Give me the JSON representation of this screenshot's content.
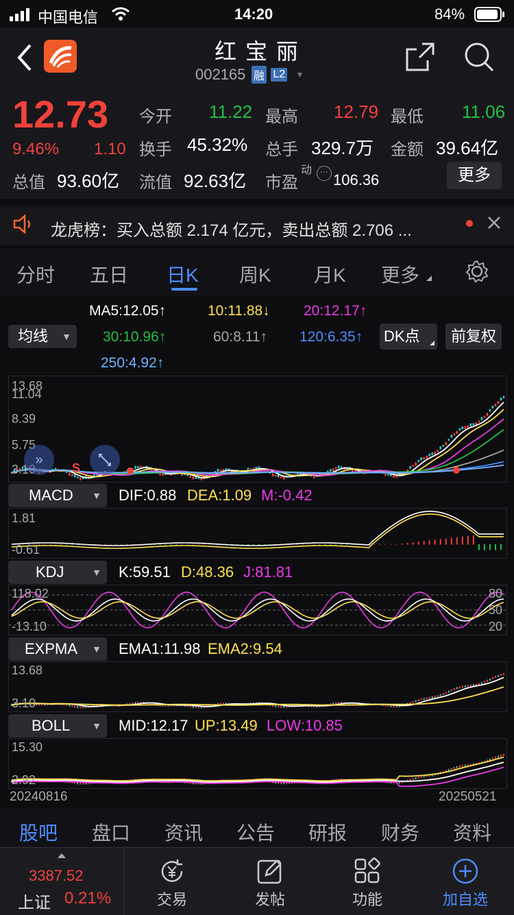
{
  "status": {
    "carrier": "中国电信",
    "time": "14:20",
    "battery": "84%"
  },
  "header": {
    "name": "红 宝 丽",
    "code": "002165",
    "badge_rong": "融",
    "badge_l2": "L2"
  },
  "quote": {
    "price": "12.73",
    "change_pct": "9.46%",
    "change": "1.10",
    "open_label": "今开",
    "open": "11.22",
    "high_label": "最高",
    "high": "12.79",
    "low_label": "最低",
    "low": "11.06",
    "turnover_label": "换手",
    "turnover": "45.32%",
    "volume_label": "总手",
    "volume": "329.7万",
    "amount_label": "金额",
    "amount": "39.64亿",
    "mktcap_label": "总值",
    "mktcap": "93.60亿",
    "float_label": "流值",
    "float": "92.63亿",
    "pe_label": "市盈",
    "pe_sup": "动",
    "pe": "106.36",
    "more_button": "更多"
  },
  "notice": {
    "text": "龙虎榜：买入总额 2.174 亿元，卖出总额 2.706 ..."
  },
  "tabs": [
    "分时",
    "五日",
    "日K",
    "周K",
    "月K",
    "更多"
  ],
  "active_tab": "日K",
  "ma_legend": {
    "dropdown": "均线",
    "ma5": "MA5:12.05↑",
    "ma10": "10:11.88↓",
    "ma20": "20:12.17↑",
    "ma30": "30:10.96↑",
    "ma60": "60:8.11↑",
    "ma120": "120:6.35↑",
    "ma250": "250:4.92↑",
    "dk_button": "DK点",
    "fq_button": "前复权"
  },
  "main_chart": {
    "y_top": "13.68",
    "y_top2": "11.04",
    "y_mid": "8.39",
    "y_low": "5.75",
    "y_bot": "3.10",
    "sell_marker": "S"
  },
  "macd": {
    "dropdown": "MACD",
    "dif": "DIF:0.88",
    "dea": "DEA:1.09",
    "m": "M:-0.42",
    "y_top": "1.81",
    "y_bot": "-0.61"
  },
  "kdj": {
    "dropdown": "KDJ",
    "k": "K:59.51",
    "d": "D:48.36",
    "j": "J:81.81",
    "y_top": "118.02",
    "y_bot": "-13.10",
    "r80": "80",
    "r50": "50",
    "r20": "20"
  },
  "expma": {
    "dropdown": "EXPMA",
    "ema1": "EMA1:11.98",
    "ema2": "EMA2:9.54",
    "y_top": "13.68",
    "y_bot": "3.10"
  },
  "boll": {
    "dropdown": "BOLL",
    "mid": "MID:12.17",
    "up": "UP:13.49",
    "low": "LOW:10.85",
    "y_top": "15.30",
    "y_bot": "2.92"
  },
  "dates": {
    "start": "20240816",
    "end": "20250521"
  },
  "bottom_tabs": [
    "股吧",
    "盘口",
    "资讯",
    "公告",
    "研报",
    "财务",
    "资料"
  ],
  "active_bottom_tab": "股吧",
  "index": {
    "value": "3387.52",
    "name": "上证",
    "pct": "0.21%"
  },
  "toolbar": {
    "trade": "交易",
    "post": "发帖",
    "func": "功能",
    "add": "加自选"
  },
  "colors": {
    "up": "#f2413b",
    "down": "#25c043",
    "accent": "#4b8dff",
    "ma5": "#ffffff",
    "ma10": "#ffe14d",
    "ma20": "#ea3be6",
    "ma30": "#25c043",
    "ma60": "#a6a6a6",
    "ma120": "#4b8dff",
    "ma250": "#6fb2ff"
  }
}
